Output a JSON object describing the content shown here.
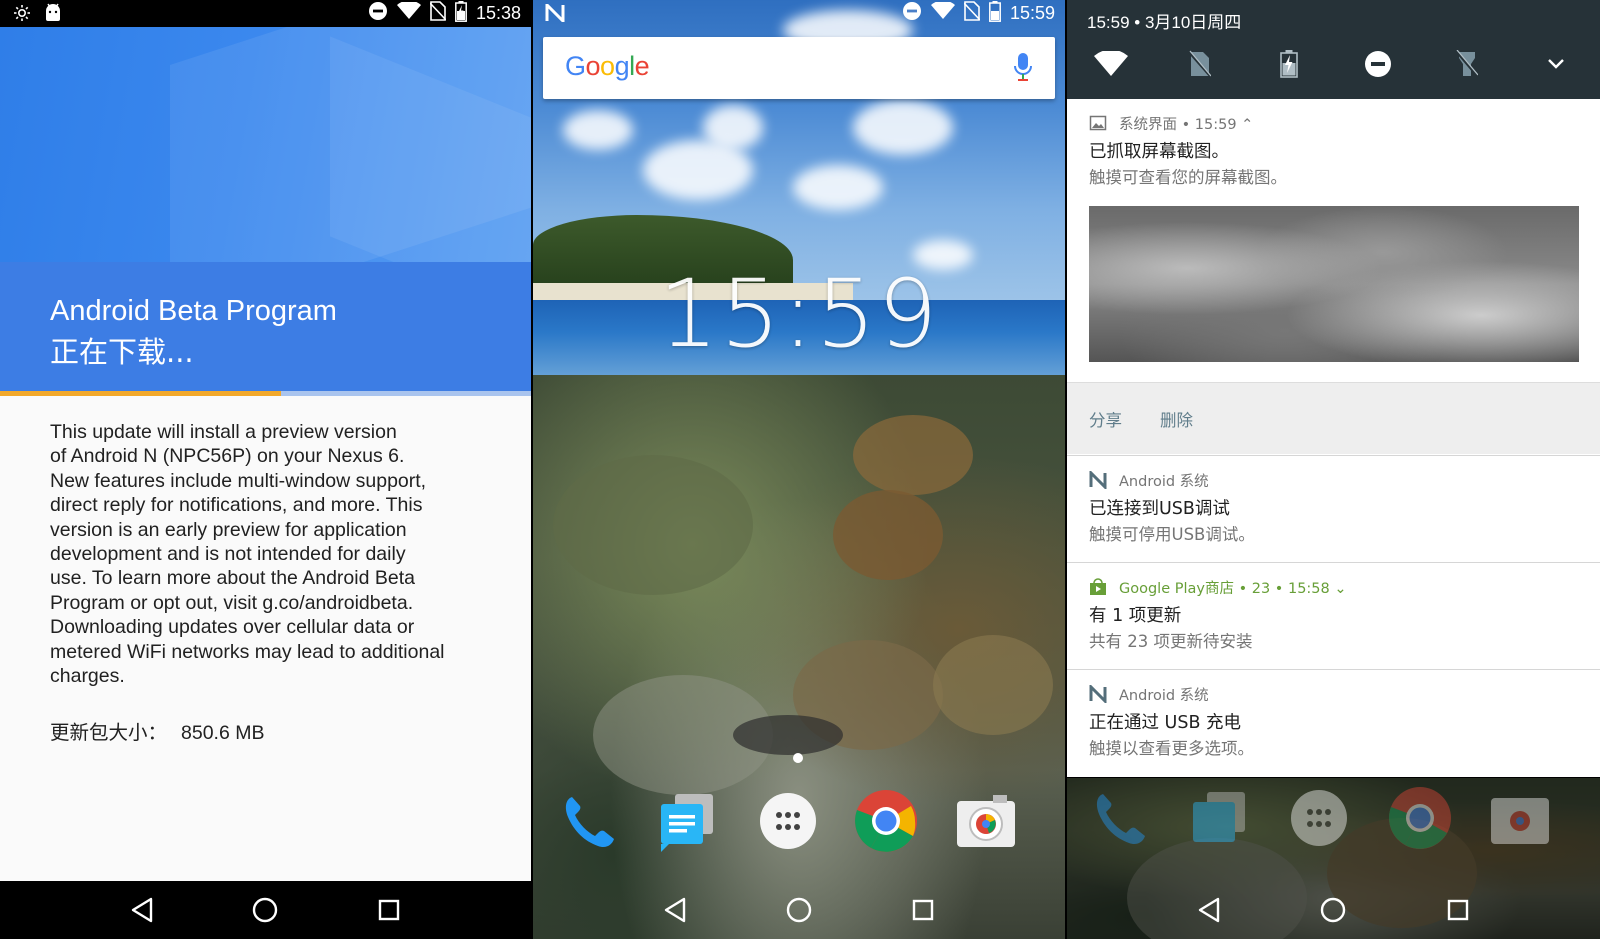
{
  "panel1": {
    "status": {
      "time": "15:38"
    },
    "title": "Android Beta Program",
    "subtitle": "正在下载...",
    "progress": 0.53,
    "body_lines": [
      "This update will install a preview version",
      "of Android N (NPC56P) on your Nexus 6.",
      "New features include multi-window support,",
      "direct reply for notifications, and more. This",
      "version is an early preview for application",
      "development and is not intended for daily",
      "use. To learn more about the Android Beta",
      "Program or opt out, visit g.co/androidbeta.",
      "Downloading updates over cellular data or",
      "metered WiFi networks may lead to additional",
      "charges."
    ],
    "size_label": "更新包大小：",
    "size_value": "850.6 MB"
  },
  "panel2": {
    "status": {
      "time": "15:59"
    },
    "search": {
      "logo": "Google"
    },
    "clock": "15:59",
    "dock": [
      "phone-icon",
      "messages-icon",
      "app-drawer-icon",
      "chrome-icon",
      "camera-icon"
    ]
  },
  "panel3": {
    "header": {
      "datetime": "15:59 • 3月10日周四"
    },
    "quick_settings": [
      "wifi-icon",
      "no-sim-icon",
      "battery-charging-icon",
      "do-not-disturb-icon",
      "flashlight-off-icon",
      "expand-icon"
    ],
    "notifications": [
      {
        "app": "系统界面 • 15:59 ⌃",
        "title": "已抓取屏幕截图。",
        "text": "触摸可查看您的屏幕截图。",
        "actions": [
          "分享",
          "删除"
        ]
      },
      {
        "app": "Android 系统",
        "title": "已连接到USB调试",
        "text": "触摸可停用USB调试。"
      },
      {
        "app": "Google Play商店 • 23 • 15:58 ⌄",
        "title": "有 1 项更新",
        "text": "共有 23 项更新待安装"
      },
      {
        "app": "Android 系统",
        "title": "正在通过 USB 充电",
        "text": "触摸以查看更多选项。"
      }
    ]
  },
  "colors": {
    "beta_blue": "#3d7de4",
    "progress_accent": "#f2a82a",
    "shade_header": "#263238",
    "play_green": "#689f38",
    "action_text": "#607d8b"
  }
}
